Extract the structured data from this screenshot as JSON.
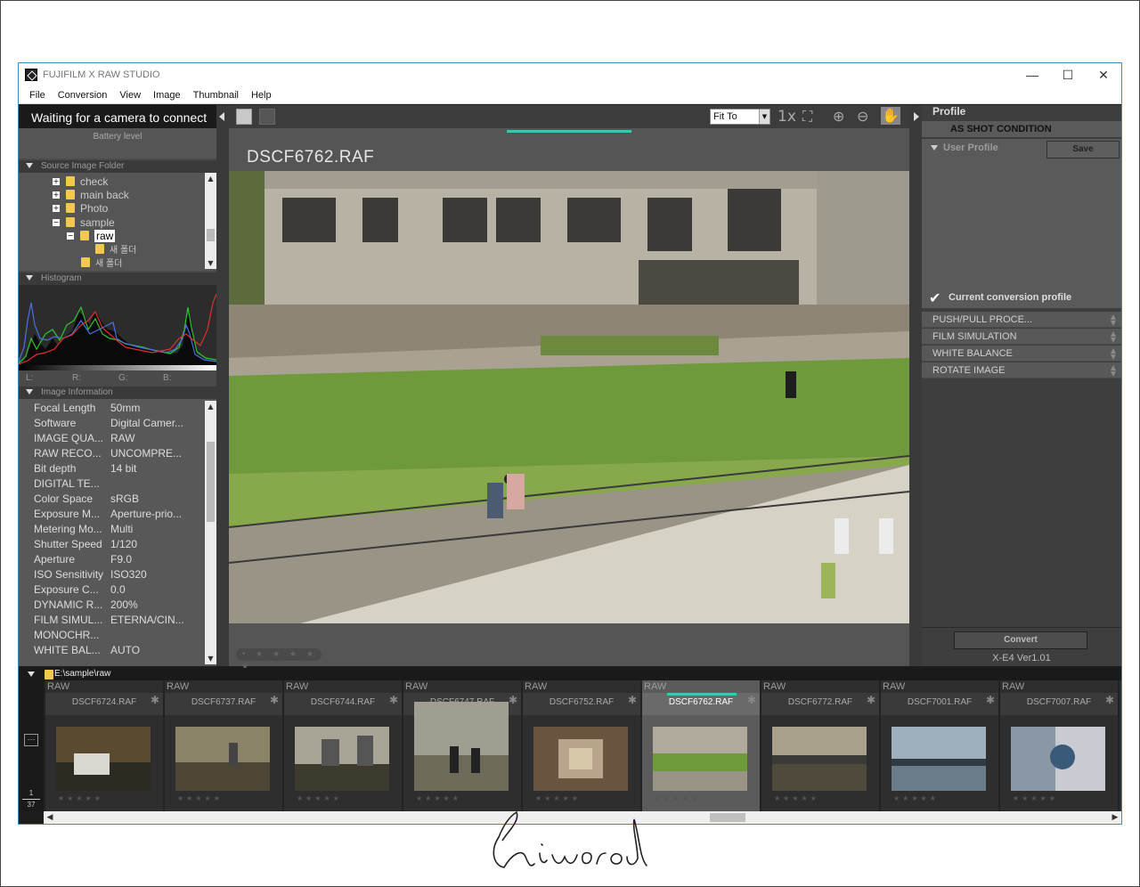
{
  "window": {
    "title": "FUJIFILM X RAW STUDIO",
    "minimize": "—",
    "maximize": "☐",
    "close": "✕"
  },
  "menu": [
    "File",
    "Conversion",
    "View",
    "Image",
    "Thumbnail",
    "Help"
  ],
  "left": {
    "camera_status": "Waiting for a camera to connect",
    "battery_label": "Battery level",
    "source_folder_title": "Source Image Folder",
    "tree": [
      {
        "label": "check",
        "depth": 0,
        "expander": "+"
      },
      {
        "label": "main back",
        "depth": 0,
        "expander": "+"
      },
      {
        "label": "Photo",
        "depth": 0,
        "expander": "+"
      },
      {
        "label": "sample",
        "depth": 0,
        "expander": "−"
      },
      {
        "label": "raw",
        "depth": 1,
        "expander": "−",
        "selected": true
      },
      {
        "label": "새 폴더",
        "depth": 2,
        "expander": ""
      },
      {
        "label": "새 폴더",
        "depth": 1,
        "expander": ""
      }
    ],
    "histogram_title": "Histogram",
    "rgb_labels": {
      "l": "L:",
      "r": "R:",
      "g": "G:",
      "b": "B:"
    },
    "image_info_title": "Image Information",
    "image_info": [
      {
        "k": "Focal Length",
        "v": "50mm"
      },
      {
        "k": "Software",
        "v": "Digital Camer..."
      },
      {
        "k": "IMAGE QUA...",
        "v": "RAW"
      },
      {
        "k": "RAW RECO...",
        "v": "UNCOMPRE..."
      },
      {
        "k": "Bit depth",
        "v": "14 bit"
      },
      {
        "k": "DIGITAL TE...",
        "v": ""
      },
      {
        "k": "Color Space",
        "v": "sRGB"
      },
      {
        "k": "Exposure M...",
        "v": "Aperture-prio..."
      },
      {
        "k": "Metering Mo...",
        "v": "Multi"
      },
      {
        "k": "Shutter Speed",
        "v": "1/120"
      },
      {
        "k": "Aperture",
        "v": "F9.0"
      },
      {
        "k": "ISO Sensitivity",
        "v": "ISO320"
      },
      {
        "k": "Exposure C...",
        "v": "0.0"
      },
      {
        "k": "DYNAMIC R...",
        "v": "200%"
      },
      {
        "k": "FILM SIMUL...",
        "v": "ETERNA/CIN..."
      },
      {
        "k": "MONOCHR...",
        "v": ""
      },
      {
        "k": "WHITE BAL...",
        "v": "AUTO"
      }
    ]
  },
  "viewer": {
    "zoom_option": "Fit To",
    "zoom_1x": "1x",
    "file_name": "DSCF6762.RAF",
    "progress_fraction": 1.0,
    "stars": "• ★ ★ ★ ★ ★"
  },
  "right": {
    "profile_title": "Profile",
    "as_shot": "AS SHOT CONDITION",
    "user_profile": "User Profile",
    "save_label": "Save",
    "current_profile": "Current conversion profile",
    "accordions": [
      "PUSH/PULL PROCE...",
      "FILM SIMULATION",
      "WHITE BALANCE",
      "ROTATE IMAGE"
    ],
    "convert_label": "Convert",
    "version": "X-E4 Ver1.01"
  },
  "filmstrip": {
    "path": "E:\\sample\\raw",
    "raw_badge": "RAW",
    "counter_current": "1",
    "counter_total": "37",
    "more_label": "···",
    "thumbnails": [
      {
        "name": "DSCF6724.RAF",
        "selected": false
      },
      {
        "name": "DSCF6737.RAF",
        "selected": false
      },
      {
        "name": "DSCF6744.RAF",
        "selected": false
      },
      {
        "name": "DSCF6747.RAF",
        "selected": false
      },
      {
        "name": "DSCF6752.RAF",
        "selected": false
      },
      {
        "name": "DSCF6762.RAF",
        "selected": true
      },
      {
        "name": "DSCF6772.RAF",
        "selected": false
      },
      {
        "name": "DSCF7001.RAF",
        "selected": false
      },
      {
        "name": "DSCF7007.RAF",
        "selected": false
      }
    ],
    "partial_badge": "R"
  },
  "colors": {
    "accent": "#38c7b0",
    "window_border": "#3b8fb4",
    "folder": "#f2c94c"
  }
}
